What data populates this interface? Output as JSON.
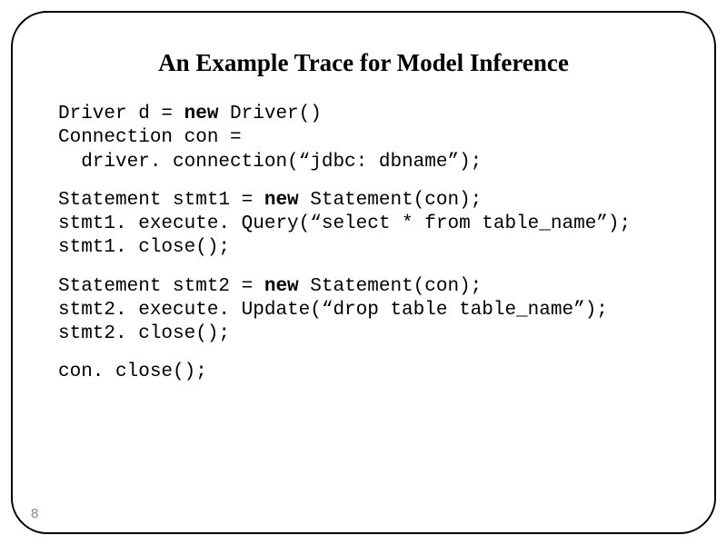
{
  "title": "An Example Trace for Model Inference",
  "code": {
    "line1a": "Driver d = ",
    "kw1": "new",
    "line1b": " Driver()",
    "line2": "Connection con =",
    "line3": "  driver. connection(“jdbc: dbname”);",
    "line4a": "Statement stmt1 = ",
    "kw2": "new",
    "line4b": " Statement(con);",
    "line5": "stmt1. execute. Query(“select * from table_name”);",
    "line6": "stmt1. close();",
    "line7a": "Statement stmt2 = ",
    "kw3": "new",
    "line7b": " Statement(con);",
    "line8": "stmt2. execute. Update(“drop table table_name”);",
    "line9": "stmt2. close();",
    "line10": "con. close();"
  },
  "pageNumber": "8"
}
